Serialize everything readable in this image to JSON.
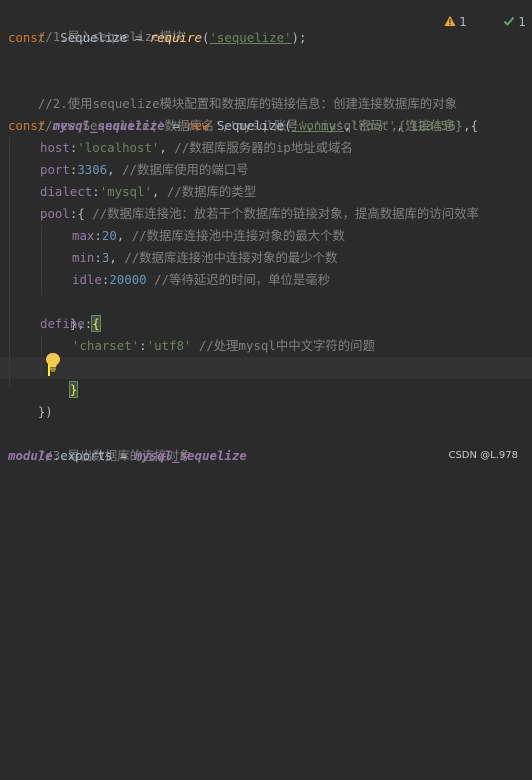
{
  "editor": {
    "lines": {
      "c1": "//1.导入sequelize模块",
      "l2": {
        "kw": "const",
        "name": "Sequelize",
        "eq": " = ",
        "fn": "require",
        "open": "(",
        "str": "'sequelize'",
        "close": ");"
      },
      "c4": "//2.使用sequelize模块配置和数据库的链接信息：创建连接数据库的对象",
      "c5": "//new Sequelize('数据库名','mysql账号','mysql密码',{连接信息}",
      "l6": {
        "kw": "const",
        "var": "mysql_sequelize",
        "eq": " = ",
        "kw2": "new",
        "cls": "Sequelize(",
        "s1": "'woniu'",
        "comma1": ",",
        "s2": "'root'",
        "comma2": ",",
        "s3": "'123456'",
        "end": ",{"
      },
      "l7": {
        "prop": "host",
        "colon": ":",
        "str": "'localhost'",
        "comma": ", ",
        "comment": "//数据库服务器的ip地址或域名"
      },
      "l8": {
        "prop": "port",
        "colon": ":",
        "num": "3306",
        "comma": ", ",
        "comment": "//数据库使用的端口号"
      },
      "l9": {
        "prop": "dialect",
        "colon": ":",
        "str": "'mysql'",
        "comma": ", ",
        "comment": "//数据库的类型"
      },
      "l10": {
        "prop": "pool",
        "colon": ":",
        "brace": "{ ",
        "comment": "//数据库连接池：放若干个数据库的链接对象，提高数据库的访问效率"
      },
      "l11": {
        "prop": "max",
        "colon": ":",
        "num": "20",
        "comma": ", ",
        "comment": "//数据库连接池中连接对象的最大个数"
      },
      "l12": {
        "prop": "min",
        "colon": ":",
        "num": "3",
        "comma": ", ",
        "comment": "//数据库连接池中连接对象的最少个数"
      },
      "l13": {
        "prop": "idle",
        "colon": ":",
        "num": "20000",
        "space": " ",
        "comment": "//等待延迟的时间，单位是毫秒"
      },
      "l14": "},",
      "l15": {
        "prop": "define",
        "colon": ":",
        "brace": "{"
      },
      "l16": {
        "str1": "'charset'",
        "colon": ":",
        "str2": "'utf8'",
        "space": " ",
        "comment": "//处理mysql中中文字符的问题"
      },
      "l17": "}",
      "l18": "})",
      "c20": "//3.导出数据库的连接对象",
      "l21": {
        "mod": "module",
        "dot": ".",
        "exp": "exports",
        "eq": " = ",
        "var": "mysql_sequelize"
      }
    }
  },
  "inspections": {
    "warnings": "1",
    "weak_warnings": "1"
  },
  "watermark": "CSDN @L.978",
  "colors": {
    "background": "#2b2b2b",
    "comment": "#808080",
    "keyword": "#cc7832",
    "property": "#9876aa",
    "string": "#6a8759",
    "number": "#6897bb",
    "function": "#ffc66d",
    "warning": "#f0a732",
    "ok": "#59a869"
  },
  "icons": {
    "bulb": "lightbulb-icon",
    "warning": "warning-triangle-icon",
    "check": "checkmark-icon"
  }
}
